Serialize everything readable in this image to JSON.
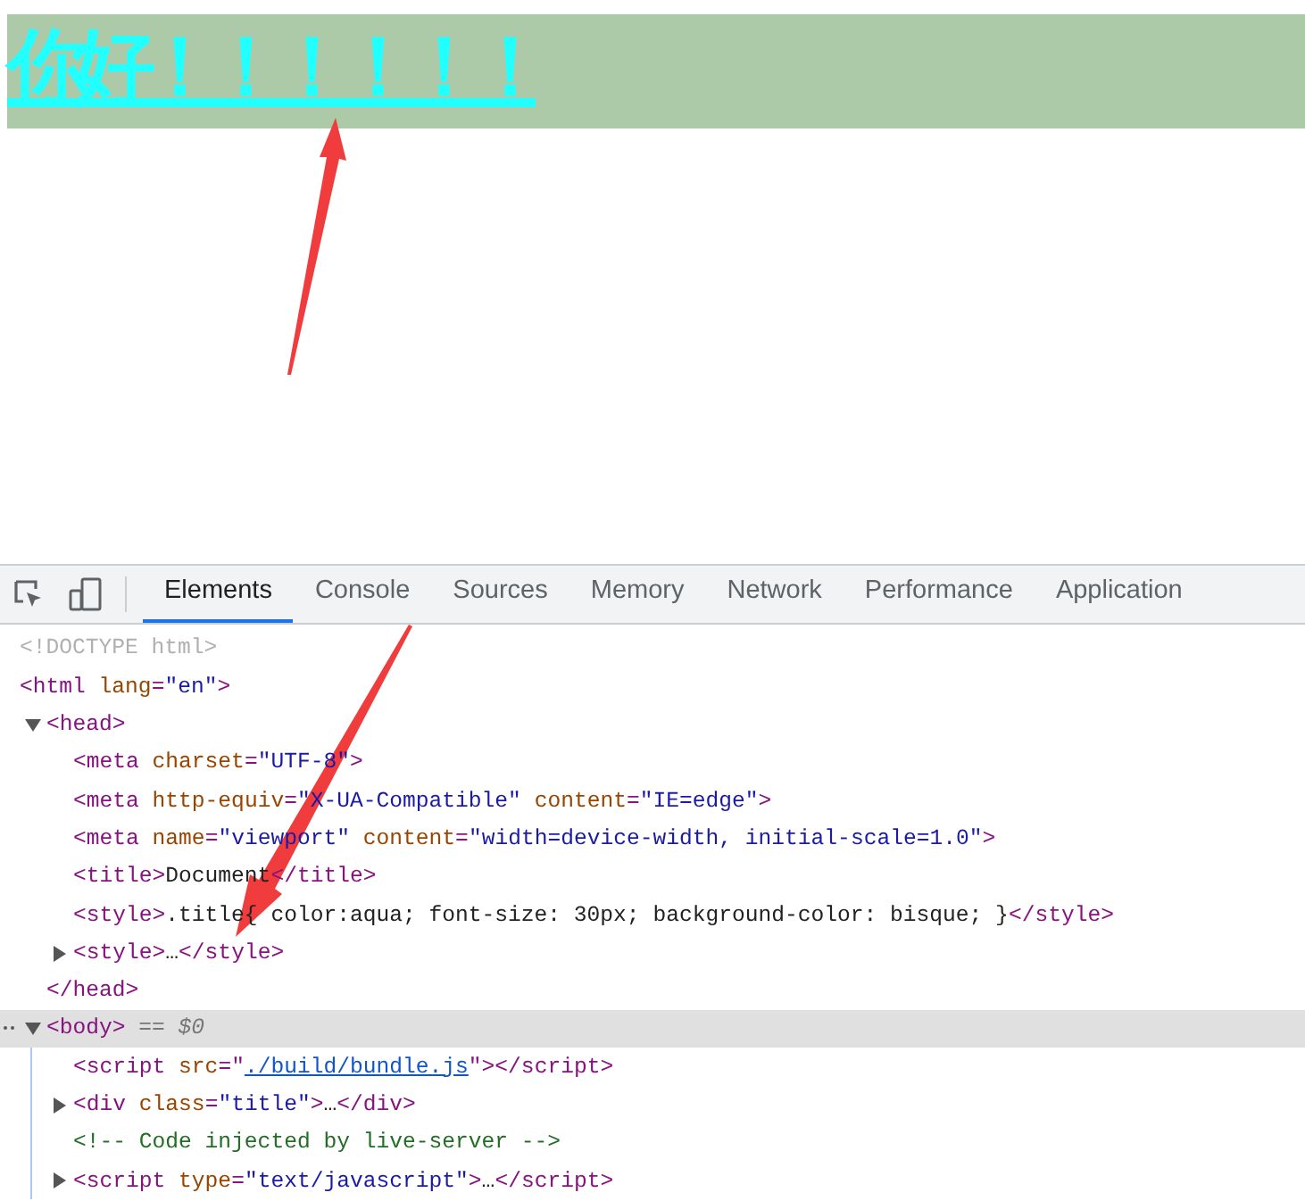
{
  "page": {
    "heading": "你好！！！！！！"
  },
  "devtools": {
    "tabs": [
      {
        "label": "Elements",
        "selected": true
      },
      {
        "label": "Console",
        "selected": false
      },
      {
        "label": "Sources",
        "selected": false
      },
      {
        "label": "Memory",
        "selected": false
      },
      {
        "label": "Network",
        "selected": false
      },
      {
        "label": "Performance",
        "selected": false
      },
      {
        "label": "Application",
        "selected": false
      }
    ],
    "tree": [
      {
        "tokens": [
          {
            "kind": "doctype",
            "text": "<!DOCTYPE html>"
          }
        ]
      },
      {
        "tokens": [
          {
            "kind": "tag",
            "text": "<html"
          },
          {
            "kind": "attr",
            "text": " lang"
          },
          {
            "kind": "punct",
            "text": "="
          },
          {
            "kind": "value",
            "text": "\"en\""
          },
          {
            "kind": "tag",
            "text": ">"
          }
        ]
      },
      {
        "expanded": true,
        "selected": false,
        "tokens": [
          {
            "kind": "tag",
            "text": "<head>"
          }
        ],
        "closing": [
          {
            "kind": "tag",
            "text": "</head>"
          }
        ],
        "children": [
          {
            "tokens": [
              {
                "kind": "tag",
                "text": "<meta"
              },
              {
                "kind": "attr",
                "text": " charset"
              },
              {
                "kind": "punct",
                "text": "="
              },
              {
                "kind": "value",
                "text": "\"UTF-8\""
              },
              {
                "kind": "tag",
                "text": ">"
              }
            ]
          },
          {
            "tokens": [
              {
                "kind": "tag",
                "text": "<meta"
              },
              {
                "kind": "attr",
                "text": " http-equiv"
              },
              {
                "kind": "punct",
                "text": "="
              },
              {
                "kind": "value",
                "text": "\"X-UA-Compatible\""
              },
              {
                "kind": "attr",
                "text": " content"
              },
              {
                "kind": "punct",
                "text": "="
              },
              {
                "kind": "value",
                "text": "\"IE=edge\""
              },
              {
                "kind": "tag",
                "text": ">"
              }
            ]
          },
          {
            "tokens": [
              {
                "kind": "tag",
                "text": "<meta"
              },
              {
                "kind": "attr",
                "text": " name"
              },
              {
                "kind": "punct",
                "text": "="
              },
              {
                "kind": "value",
                "text": "\"viewport\""
              },
              {
                "kind": "attr",
                "text": " content"
              },
              {
                "kind": "punct",
                "text": "="
              },
              {
                "kind": "value",
                "text": "\"width=device-width, initial-scale=1.0\""
              },
              {
                "kind": "tag",
                "text": ">"
              }
            ]
          },
          {
            "tokens": [
              {
                "kind": "tag",
                "text": "<title>"
              },
              {
                "kind": "text",
                "text": "Document"
              },
              {
                "kind": "tag",
                "text": "</title>"
              }
            ]
          },
          {
            "tokens": [
              {
                "kind": "tag",
                "text": "<style>"
              },
              {
                "kind": "text",
                "text": ".title{ color:aqua; font-size: 30px; background-color: bisque; }"
              },
              {
                "kind": "tag",
                "text": "</style>"
              }
            ]
          },
          {
            "expanded": false,
            "tokens": [
              {
                "kind": "tag",
                "text": "<style>"
              },
              {
                "kind": "text",
                "text": "…"
              },
              {
                "kind": "tag",
                "text": "</style>"
              }
            ]
          }
        ]
      },
      {
        "expanded": true,
        "selected": true,
        "tokens": [
          {
            "kind": "tag",
            "text": "<body>"
          },
          {
            "kind": "marker",
            "text": " == $0"
          }
        ],
        "children": [
          {
            "tokens": [
              {
                "kind": "tag",
                "text": "<script"
              },
              {
                "kind": "attr",
                "text": " src"
              },
              {
                "kind": "punct",
                "text": "=\""
              },
              {
                "kind": "link",
                "text": "./build/bundle.js"
              },
              {
                "kind": "punct",
                "text": "\""
              },
              {
                "kind": "tag",
                "text": "></script>"
              }
            ]
          },
          {
            "expanded": false,
            "tokens": [
              {
                "kind": "tag",
                "text": "<div"
              },
              {
                "kind": "attr",
                "text": " class"
              },
              {
                "kind": "punct",
                "text": "="
              },
              {
                "kind": "value",
                "text": "\"title\""
              },
              {
                "kind": "tag",
                "text": ">"
              },
              {
                "kind": "text",
                "text": "…"
              },
              {
                "kind": "tag",
                "text": "</div>"
              }
            ]
          },
          {
            "tokens": [
              {
                "kind": "comment",
                "text": "<!-- Code injected by live-server -->"
              }
            ]
          },
          {
            "expanded": false,
            "tokens": [
              {
                "kind": "tag",
                "text": "<script"
              },
              {
                "kind": "attr",
                "text": " type"
              },
              {
                "kind": "punct",
                "text": "="
              },
              {
                "kind": "value",
                "text": "\"text/javascript\""
              },
              {
                "kind": "tag",
                "text": ">"
              },
              {
                "kind": "text",
                "text": "…"
              },
              {
                "kind": "tag",
                "text": "</script>"
              }
            ]
          }
        ]
      }
    ]
  }
}
